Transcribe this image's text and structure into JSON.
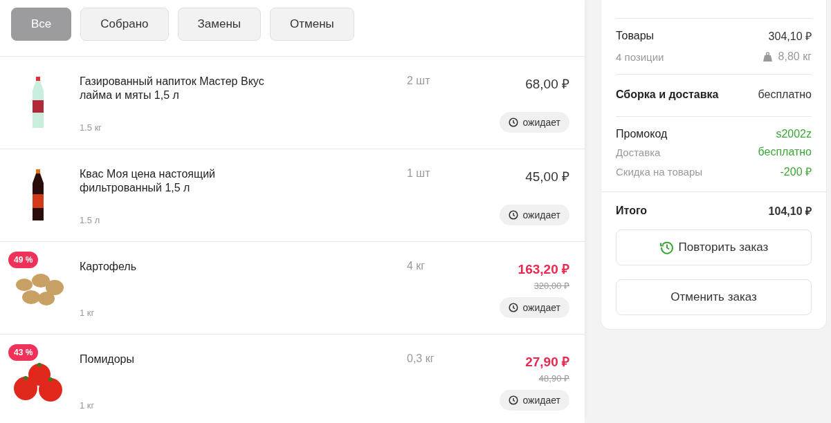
{
  "filters": [
    {
      "label": "Все",
      "selected": true
    },
    {
      "label": "Собрано",
      "selected": false
    },
    {
      "label": "Замены",
      "selected": false
    },
    {
      "label": "Отмены",
      "selected": false
    }
  ],
  "items": [
    {
      "kind": "green-bottle",
      "name": "Газированный напиток Мастер Вкус лайма и мяты 1,5 л",
      "unit": "1.5 кг",
      "quantity": "2 шт",
      "price": "68,00 ₽",
      "status": "ожидает"
    },
    {
      "kind": "dark-bottle",
      "name": "Квас Моя цена настоящий фильтрованный 1,5 л",
      "unit": "1.5 л",
      "quantity": "1 шт",
      "price": "45,00 ₽",
      "status": "ожидает"
    },
    {
      "kind": "potato",
      "discount": "49 %",
      "name": "Картофель",
      "unit": "1 кг",
      "quantity": "4 кг",
      "price": "163,20 ₽",
      "old_price": "320,00 ₽",
      "status": "ожидает"
    },
    {
      "kind": "tomato",
      "discount": "43 %",
      "name": "Помидоры",
      "unit": "1 кг",
      "quantity": "0,3 кг",
      "price": "27,90 ₽",
      "old_price": "48,90 ₽",
      "status": "ожидает"
    }
  ],
  "summary": {
    "goods": {
      "label": "Товары",
      "value": "304,10 ₽",
      "count": "4 позиции",
      "weight": "8,80 кг"
    },
    "assembly": {
      "label": "Сборка и доставка",
      "value": "бесплатно"
    },
    "details": [
      {
        "kind": "main",
        "label": "Промокод",
        "value": "s2002z"
      },
      {
        "kind": "sub",
        "label": "Доставка",
        "value": "бесплатно"
      },
      {
        "kind": "sub",
        "label": "Скидка на товары",
        "value": "-200 ₽"
      }
    ],
    "total": {
      "label": "Итого",
      "value": "104,10 ₽"
    },
    "buttons": [
      {
        "kind": "repeat",
        "label": "Повторить заказ"
      },
      {
        "kind": "plain",
        "label": "Отменить заказ"
      }
    ]
  }
}
